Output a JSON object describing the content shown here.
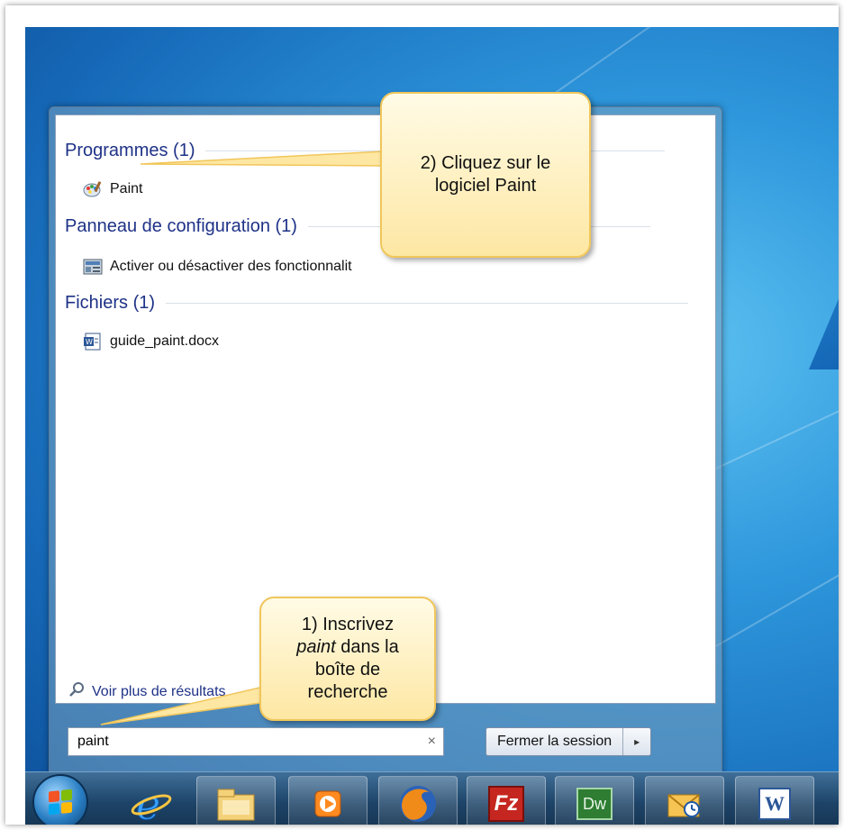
{
  "results": {
    "sections": [
      {
        "title": "Programmes (1)",
        "item": "Paint",
        "icon": "paint-app-icon"
      },
      {
        "title": "Panneau de configuration (1)",
        "item": "Activer ou désactiver des fonctionnalit",
        "icon": "control-panel-icon"
      },
      {
        "title": "Fichiers (1)",
        "item": "guide_paint.docx",
        "icon": "word-document-icon"
      }
    ],
    "more_results": "Voir plus de résultats"
  },
  "search": {
    "value": "paint",
    "clear": "×"
  },
  "shutdown": {
    "label": "Fermer la session",
    "arrow": "▸"
  },
  "callouts": {
    "step2": [
      "2) Cliquez sur le",
      "logiciel Paint"
    ],
    "step1_line1": "1) Inscrivez",
    "step1_em": "paint",
    "step1_rest": " dans la",
    "step1_line3": "boîte de",
    "step1_line4": "recherche"
  },
  "taskbar": {
    "items": [
      "start-orb-icon",
      "internet-explorer-icon",
      "file-explorer-icon",
      "media-player-icon",
      "firefox-icon",
      "filezilla-icon",
      "dreamweaver-icon",
      "outlook-icon",
      "word-icon"
    ],
    "labels": {
      "filezilla": "Fz",
      "dreamweaver": "Dw",
      "word": "W"
    }
  },
  "colors": {
    "accent": "#1e3287",
    "callout_border": "#f1c65a",
    "callout_fill": "#fde7a3"
  }
}
